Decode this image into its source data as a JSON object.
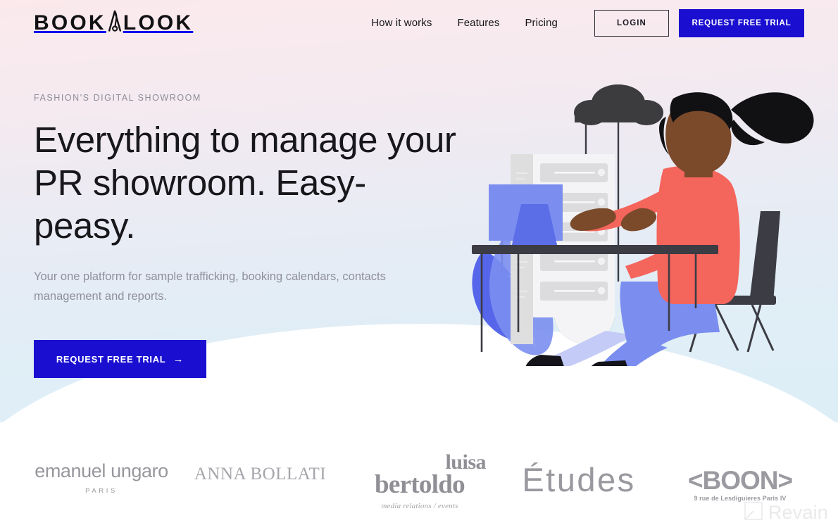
{
  "brand": {
    "name_part1": "BOOK",
    "name_part2": "LOOK",
    "logo_icon": "safety-pin-icon",
    "accent_blue": "#1a0fd0",
    "text_dark": "#18181c",
    "muted_grey": "#8f8f9c"
  },
  "header": {
    "nav": [
      {
        "label": "How it works"
      },
      {
        "label": "Features"
      },
      {
        "label": "Pricing"
      }
    ],
    "login_label": "LOGIN",
    "trial_label": "REQUEST FREE TRIAL"
  },
  "hero": {
    "eyebrow": "FASHION'S DIGITAL SHOWROOM",
    "headline_line1": "Everything to manage your",
    "headline_line2": "PR showroom. Easy-peasy.",
    "subcopy": "Your one platform for sample trafficking, booking calendars, contacts management and reports.",
    "cta_label": "REQUEST FREE TRIAL",
    "cta_arrow": "→"
  },
  "illustration": {
    "description": "woman-at-desk-with-server-rack-and-cloud",
    "colors": {
      "cloud": "#3c3c3f",
      "server_body": "#f1f1f3",
      "server_side": "#dededf",
      "server_row": "#dcdcde",
      "server_base_green": "#1f8a49",
      "leaf_light": "#7b8ef0",
      "leaf_dark": "#4a5ae8",
      "monitor": "#7b8ef0",
      "laptop": "#5b6ee8",
      "shirt": "#f4655c",
      "pants": "#7b8ef0",
      "skin": "#7a4a2b",
      "hair": "#111114",
      "desk": "#3c3c44",
      "chair": "#3c3c44",
      "shoes": "#14141a"
    }
  },
  "clients": [
    {
      "id": "emanuel-ungaro",
      "main": "emanuel ungaro",
      "sub": "PARIS"
    },
    {
      "id": "anna-bollati",
      "main": "ANNA BOLLATI",
      "sub": ""
    },
    {
      "id": "luisa-bertoldo",
      "line1": "luisa",
      "line2": "bertoldo",
      "sub": "media relations / events"
    },
    {
      "id": "etudes",
      "main": "Études",
      "sub": ""
    },
    {
      "id": "boon",
      "main": "<BOON>",
      "sub": "9 rue de Lesdiguieres Paris IV"
    }
  ],
  "watermark": {
    "label": "Revain",
    "icon": "revain-square-icon"
  }
}
